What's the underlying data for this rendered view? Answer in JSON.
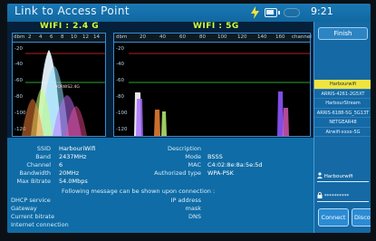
{
  "header": {
    "title": "Link to Access Point",
    "time": "9:21"
  },
  "charts": {
    "wifi24": {
      "title": "WIFI : 2.4 G",
      "x_ticks": [
        "dbm",
        "2",
        "4",
        "6",
        "8",
        "10",
        "12",
        "14"
      ],
      "y_ticks": [
        "-20",
        "-40",
        "-60",
        "-80",
        "-100",
        "-120"
      ],
      "network_label": "HORWS2.4G"
    },
    "wifi5": {
      "title": "WIFI : 5G",
      "x_ticks": [
        "dbm",
        "20",
        "40",
        "60",
        "80",
        "100",
        "120",
        "140",
        "160",
        "channel"
      ],
      "y_ticks": [
        "-20",
        "-40",
        "-60",
        "-80",
        "-100",
        "-120"
      ]
    }
  },
  "info": {
    "left_labels": [
      "SSID",
      "Band",
      "Channel",
      "Bandwidth",
      "Max Bitrate"
    ],
    "left_values": [
      "HarbouriWifi",
      "2437MHz",
      "6",
      "20MHz",
      "54.0Mbps"
    ],
    "right_labels": [
      "Description",
      "Mode",
      "MAC",
      "Authorized type"
    ],
    "right_values": [
      "",
      "BSSS",
      "C4:02:8e:8a:5e:5d",
      "WPA-PSK"
    ],
    "connection_note": "Following message can be shown upon connection :",
    "conn_labels_left": [
      "DHCP service",
      "Gateway",
      "Current bitrate",
      "Internet connection"
    ],
    "conn_labels_right": [
      "IP address",
      "mask",
      "DNS"
    ]
  },
  "right_panel": {
    "finish_label": "Finish",
    "networks": [
      "Harbourwifi",
      "ARRIS-4261-2G5XT",
      "HarbourStream",
      "ARRIS-6188-5G_5G13T",
      "NETGEAR48",
      "Airwifi-xxxx-5G"
    ],
    "selected_index": 0,
    "username": "Harbourwifi",
    "password_mask": "**********",
    "connect_label": "Connect",
    "disconnect_label": "Disconne"
  }
}
